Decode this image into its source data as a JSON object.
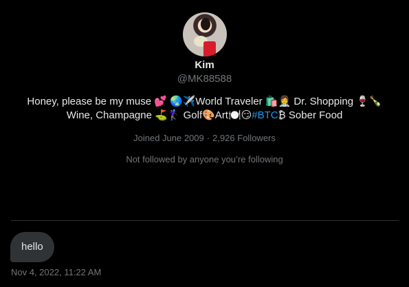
{
  "profile": {
    "name": "Kim",
    "handle": "@MK88588",
    "bio_line1": "Honey, please be my muse 💕 🌏✈️World Traveler 🛍️👩‍⚕️ Dr. Shopping 🍷🍾",
    "bio_line2_prefix": "Wine, Champagne ⛳🏌️‍♀️ Golf🎨Art🍽️😏",
    "bio_hashtag": "#BTC",
    "bio_line2_suffix": "₿ Sober Food",
    "joined": "Joined June 2009",
    "separator": "·",
    "followers": "2,926 Followers",
    "not_followed": "Not followed by anyone you’re following"
  },
  "message": {
    "text": "hello",
    "timestamp": "Nov 4, 2022, 11:22 AM"
  },
  "colors": {
    "background": "#000000",
    "text": "#e7e9ea",
    "muted": "#71767b",
    "bubble": "#2f3336",
    "link": "#1d9bf0"
  }
}
